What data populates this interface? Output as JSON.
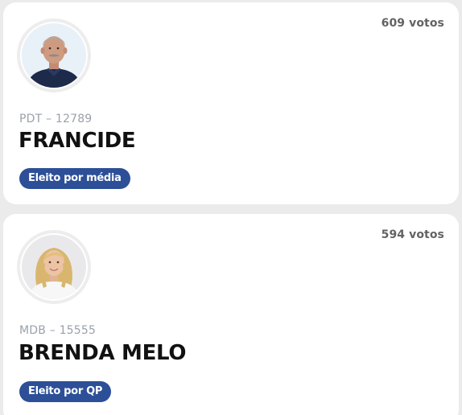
{
  "candidates": [
    {
      "votes": "609 votos",
      "party": "PDT – 12789",
      "name": "FRANCIDE",
      "status": "Eleito por média",
      "photo": "portrait-older-man"
    },
    {
      "votes": "594 votos",
      "party": "MDB – 15555",
      "name": "BRENDA MELO",
      "status": "Eleito por QP",
      "photo": "portrait-woman"
    }
  ],
  "colors": {
    "badge_bg": "#2c4f98",
    "page_bg": "#ebebeb",
    "card_bg": "#ffffff"
  }
}
